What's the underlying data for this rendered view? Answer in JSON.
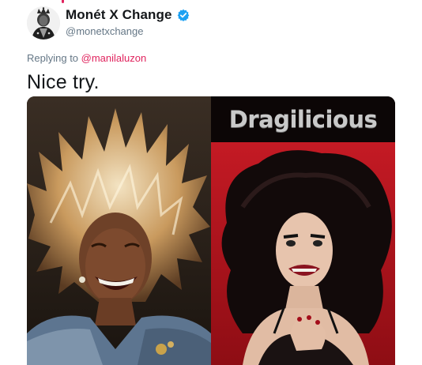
{
  "tweet": {
    "author": {
      "display_name": "Monét X Change",
      "handle": "@monetxchange",
      "verified": true,
      "avatar_icon": "crowned-portrait-avatar"
    },
    "reply_context": {
      "prefix": "Replying to ",
      "mention": "@manilaluzon"
    },
    "text": "Nice try.",
    "media": {
      "left_photo": {
        "subject": "performer with voluminous spiky blonde hair in denim jacket, laughing"
      },
      "right_photo": {
        "subject": "drag performer with large black teased wig, snarling pose",
        "watermark": "Dragilicious"
      }
    }
  },
  "colors": {
    "name": "#14171a",
    "secondary": "#657786",
    "mention": "#e0245e",
    "verified": "#1da1f2",
    "right_photo_bg": "#b5121b"
  }
}
